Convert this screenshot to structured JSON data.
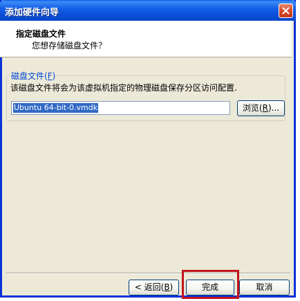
{
  "window": {
    "title": "添加硬件向导",
    "close_icon": "close-icon"
  },
  "header": {
    "title": "指定磁盘文件",
    "subtitle": "您想存储磁盘文件？"
  },
  "disk_file_group": {
    "legend_text": "磁盘文件",
    "legend_mnemonic": "F",
    "description": "该磁盘文件将会为该虚拟机指定的物理磁盘保存分区访问配置.",
    "path_value": "Ubuntu 64-bit-0.vmdk",
    "browse_label": "浏览",
    "browse_mnemonic": "R"
  },
  "footer": {
    "back_label": "< 返回",
    "back_mnemonic": "B",
    "finish_label": "完成",
    "cancel_label": "取消"
  },
  "colors": {
    "highlight_box": "#c0141b",
    "title_bar": "#0b4fd8",
    "dialog_bg": "#ece9d8"
  }
}
